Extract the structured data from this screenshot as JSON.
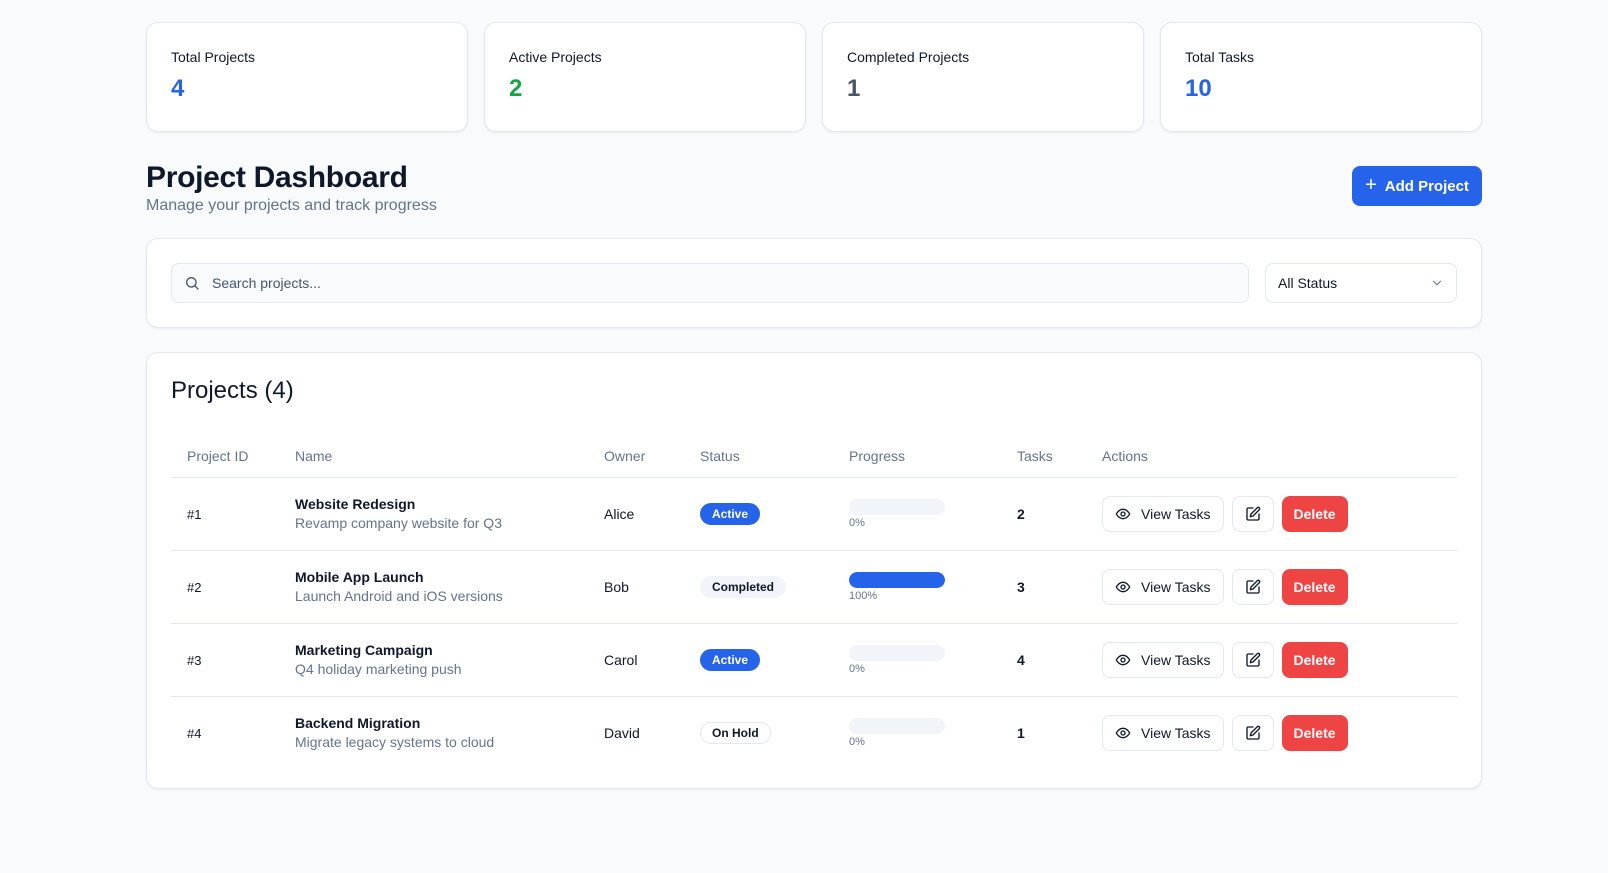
{
  "stats": [
    {
      "label": "Total Projects",
      "value": "4",
      "color": "#2563eb"
    },
    {
      "label": "Active Projects",
      "value": "2",
      "color": "#16a34a"
    },
    {
      "label": "Completed Projects",
      "value": "1",
      "color": "#475569"
    },
    {
      "label": "Total Tasks",
      "value": "10",
      "color": "#2563eb"
    }
  ],
  "header": {
    "title": "Project Dashboard",
    "subtitle": "Manage your projects and track progress",
    "add_button": {
      "icon": "plus-icon",
      "label": "Add Project",
      "color": "#2563eb"
    }
  },
  "filters": {
    "search": {
      "icon": "search-icon",
      "placeholder": "Search projects...",
      "value": ""
    },
    "status": {
      "selected": "All Status",
      "icon": "chevron-down-icon"
    }
  },
  "projects": {
    "title": "Projects (4)",
    "columns": [
      "Project ID",
      "Name",
      "Owner",
      "Status",
      "Progress",
      "Tasks",
      "Actions"
    ],
    "rows": [
      {
        "id": "#1",
        "name": "Website Redesign",
        "description": "Revamp company website for Q3",
        "owner": "Alice",
        "status": "Active",
        "status_kind": "active",
        "progress": 0,
        "progress_label": "0%",
        "tasks": "2"
      },
      {
        "id": "#2",
        "name": "Mobile App Launch",
        "description": "Launch Android and iOS versions",
        "owner": "Bob",
        "status": "Completed",
        "status_kind": "completed",
        "progress": 100,
        "progress_label": "100%",
        "tasks": "3"
      },
      {
        "id": "#3",
        "name": "Marketing Campaign",
        "description": "Q4 holiday marketing push",
        "owner": "Carol",
        "status": "Active",
        "status_kind": "active",
        "progress": 0,
        "progress_label": "0%",
        "tasks": "4"
      },
      {
        "id": "#4",
        "name": "Backend Migration",
        "description": "Migrate legacy systems to cloud",
        "owner": "David",
        "status": "On Hold",
        "status_kind": "onhold",
        "progress": 0,
        "progress_label": "0%",
        "tasks": "1"
      }
    ],
    "actions": {
      "view_label": "View Tasks",
      "view_icon": "eye-icon",
      "edit_icon": "edit-icon",
      "delete_label": "Delete",
      "delete_color": "#ef4444"
    }
  }
}
